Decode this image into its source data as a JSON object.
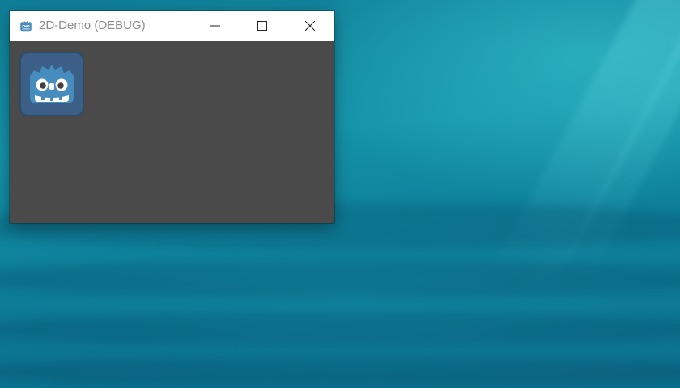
{
  "desktop": {
    "wallpaper": "ocean-water"
  },
  "window": {
    "title": "2D-Demo (DEBUG)",
    "app_icon": "godot-icon",
    "controls": {
      "minimize": "minimize-icon",
      "maximize": "maximize-icon",
      "close": "close-icon"
    },
    "client_background": "#4a4a4a",
    "sprite": "godot-logo"
  },
  "colors": {
    "godot_blue": "#478cbf",
    "sprite_frame": "#2e4a66",
    "title_text": "#8c8c8c"
  }
}
